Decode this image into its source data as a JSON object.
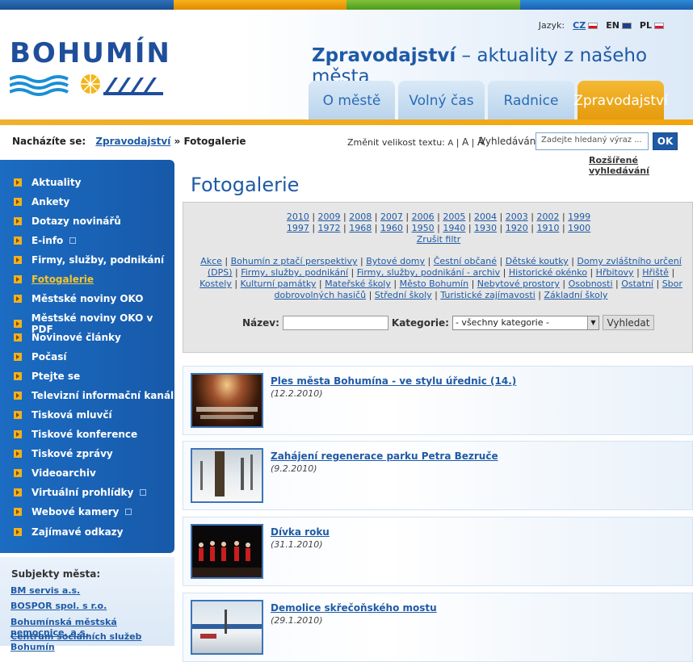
{
  "language": {
    "label": "Jazyk:",
    "options": [
      "CZ",
      "EN",
      "PL"
    ]
  },
  "logo": {
    "text": "BOHUMÍN"
  },
  "headline": {
    "section": "Zpravodajství",
    "rest": " – aktuality z našeho města"
  },
  "nav": {
    "tabs": [
      {
        "label": "O městě",
        "active": false
      },
      {
        "label": "Volný čas",
        "active": false
      },
      {
        "label": "Radnice",
        "active": false
      },
      {
        "label": "Zpravodajství",
        "active": true
      }
    ]
  },
  "breadcrumb": {
    "label": "Nacházíte se:",
    "parent": "Zpravodajství",
    "separator": "»",
    "current": "Fotogalerie"
  },
  "text_size": {
    "label": "Změnit velikost textu:",
    "small": "A",
    "medium": "A",
    "large": "A"
  },
  "search": {
    "label": "Vyhledávání:",
    "placeholder": "Zadejte hledaný výraz ...",
    "button": "OK",
    "advanced": "Rozšířené vyhledávání"
  },
  "sidebar": {
    "items": [
      {
        "label": "Aktuality",
        "active": false,
        "external": false
      },
      {
        "label": "Ankety",
        "active": false,
        "external": false
      },
      {
        "label": "Dotazy novinářů",
        "active": false,
        "external": false
      },
      {
        "label": "E-info",
        "active": false,
        "external": true
      },
      {
        "label": "Firmy, služby, podnikání",
        "active": false,
        "external": false
      },
      {
        "label": "Fotogalerie",
        "active": true,
        "external": false
      },
      {
        "label": "Městské noviny OKO",
        "active": false,
        "external": false
      },
      {
        "label": "Městské noviny OKO v PDF",
        "active": false,
        "external": false
      },
      {
        "label": "Novinové články",
        "active": false,
        "external": false
      },
      {
        "label": "Počasí",
        "active": false,
        "external": false
      },
      {
        "label": "Ptejte se",
        "active": false,
        "external": false
      },
      {
        "label": "Televizní informační kanál",
        "active": false,
        "external": false
      },
      {
        "label": "Tisková mluvčí",
        "active": false,
        "external": false
      },
      {
        "label": "Tiskové konference",
        "active": false,
        "external": false
      },
      {
        "label": "Tiskové zprávy",
        "active": false,
        "external": false
      },
      {
        "label": "Videoarchiv",
        "active": false,
        "external": false
      },
      {
        "label": "Virtuální prohlídky",
        "active": false,
        "external": true
      },
      {
        "label": "Webové kamery",
        "active": false,
        "external": true
      },
      {
        "label": "Zajímavé odkazy",
        "active": false,
        "external": false
      }
    ]
  },
  "subjects": {
    "heading": "Subjekty města:",
    "items": [
      "BM servis a.s.",
      "BOSPOR spol. s r.o.",
      "Bohumínská městská nemocnice, a.s.",
      "Centrum sociálních služeb Bohumín"
    ]
  },
  "main": {
    "title": "Fotogalerie",
    "years_row1": [
      "2010",
      "2009",
      "2008",
      "2007",
      "2006",
      "2005",
      "2004",
      "2003",
      "2002",
      "1999"
    ],
    "years_row2": [
      "1997",
      "1972",
      "1968",
      "1960",
      "1950",
      "1940",
      "1930",
      "1920",
      "1910",
      "1900"
    ],
    "reset_filter": "Zrušit filtr",
    "categories": [
      "Akce",
      "Bohumín z ptačí perspektivy",
      "Bytové domy",
      "Čestní občané",
      "Dětské koutky",
      "Domy zvláštního určení (DPS)",
      "Firmy, služby, podnikání",
      "Firmy, služby, podnikání - archiv",
      "Historické okénko",
      "Hřbitovy",
      "Hřiště",
      "Kostely",
      "Kulturní památky",
      "Mateřské školy",
      "Město Bohumín",
      "Nebytové prostory",
      "Osobnosti",
      "Ostatní",
      "Sbor dobrovolných hasičů",
      "Střední školy",
      "Turistické zajímavosti",
      "Základní školy"
    ],
    "form": {
      "name_label": "Název:",
      "category_label": "Kategorie:",
      "category_selected": "- všechny kategorie -",
      "search_button": "Vyhledat"
    },
    "gallery": [
      {
        "title": "Ples města Bohumína - ve stylu úřednic (14.)",
        "date": "(12.2.2010)",
        "thumb": "ballroom-photo"
      },
      {
        "title": "Zahájení regenerace parku Petra Bezruče",
        "date": "(9.2.2010)",
        "thumb": "snowy-park-photo"
      },
      {
        "title": "Dívka roku",
        "date": "(31.1.2010)",
        "thumb": "stage-dancers-photo"
      },
      {
        "title": "Demolice skřečoňského mostu",
        "date": "(29.1.2010)",
        "thumb": "bridge-demolition-photo"
      }
    ]
  },
  "colors": {
    "brand_blue": "#1f5aa6",
    "accent_orange": "#f0b020",
    "sidebar_blue": "#1b6cc2"
  }
}
